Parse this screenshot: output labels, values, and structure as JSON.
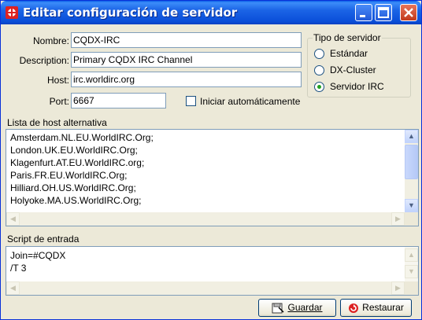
{
  "window": {
    "title": "Editar configuración de servidor"
  },
  "form": {
    "nombre_label": "Nombre:",
    "nombre_value": "CQDX-IRC",
    "description_label": "Description:",
    "description_value": "Primary CQDX IRC Channel",
    "host_label": "Host:",
    "host_value": "irc.worldirc.org",
    "port_label": "Port:",
    "port_value": "6667",
    "autostart_label": "Iniciar automáticamente"
  },
  "server_type": {
    "legend": "Tipo de servidor",
    "options": [
      "Estándar",
      "DX-Cluster",
      "Servidor IRC"
    ],
    "selected": "Servidor IRC"
  },
  "alt_hosts": {
    "label": "Lista de host alternativa",
    "lines": [
      "Amsterdam.NL.EU.WorldIRC.Org;",
      "London.UK.EU.WorldIRC.Org;",
      "Klagenfurt.AT.EU.WorldIRC.org;",
      "Paris.FR.EU.WorldIRC.Org;",
      "Hilliard.OH.US.WorldIRC.Org;",
      "Holyoke.MA.US.WorldIRC.Org;"
    ]
  },
  "script": {
    "label": "Script de entrada",
    "lines": [
      "Join=#CQDX",
      "/T 3"
    ]
  },
  "buttons": {
    "save": "Guardar",
    "restore": "Restaurar"
  },
  "icons": {
    "app": "app-icon",
    "save": "save-icon",
    "restore": "restore-icon"
  },
  "colors": {
    "titlebar": "#0a4ed8",
    "face": "#ece9d8",
    "radio_dot": "#21a121"
  }
}
